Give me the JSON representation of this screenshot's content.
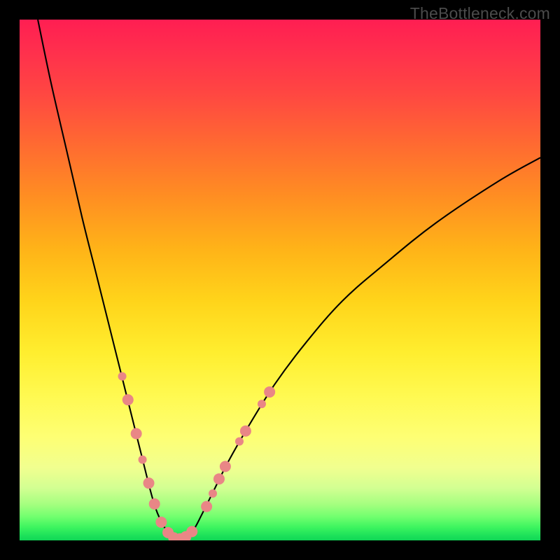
{
  "watermark": "TheBottleneck.com",
  "colors": {
    "frame": "#000000",
    "curve": "#000000",
    "marker_fill": "#e98686",
    "marker_stroke": "#d66d6d"
  },
  "chart_data": {
    "type": "line",
    "title": "",
    "xlabel": "",
    "ylabel": "",
    "xlim": [
      0,
      100
    ],
    "ylim": [
      0,
      100
    ],
    "grid": false,
    "legend": false,
    "series": [
      {
        "name": "bottleneck-curve",
        "x": [
          3.5,
          6,
          9,
          12,
          14.5,
          17,
          19,
          21,
          22.5,
          24,
          25,
          26,
          27,
          28,
          29,
          30,
          31,
          32,
          33.5,
          35,
          37,
          40,
          44,
          49,
          55,
          62,
          70,
          80,
          92,
          100
        ],
        "y": [
          100,
          88,
          75,
          62,
          52,
          42,
          34,
          26,
          20,
          14,
          10,
          6.5,
          4,
          2.2,
          1,
          0.3,
          0.2,
          0.8,
          2.2,
          5,
          9,
          15,
          22,
          30,
          38,
          46,
          53,
          61,
          69,
          73.5
        ]
      }
    ],
    "markers": [
      {
        "x": 19.7,
        "y": 31.5,
        "r": 6
      },
      {
        "x": 20.8,
        "y": 27.0,
        "r": 8
      },
      {
        "x": 22.4,
        "y": 20.5,
        "r": 8
      },
      {
        "x": 23.6,
        "y": 15.5,
        "r": 6
      },
      {
        "x": 24.8,
        "y": 11.0,
        "r": 8
      },
      {
        "x": 25.9,
        "y": 7.0,
        "r": 8
      },
      {
        "x": 27.2,
        "y": 3.5,
        "r": 8
      },
      {
        "x": 28.5,
        "y": 1.5,
        "r": 8
      },
      {
        "x": 29.6,
        "y": 0.5,
        "r": 8
      },
      {
        "x": 30.8,
        "y": 0.3,
        "r": 8
      },
      {
        "x": 31.9,
        "y": 0.7,
        "r": 8
      },
      {
        "x": 33.1,
        "y": 1.7,
        "r": 8
      },
      {
        "x": 35.9,
        "y": 6.5,
        "r": 8
      },
      {
        "x": 37.1,
        "y": 9.0,
        "r": 6
      },
      {
        "x": 38.3,
        "y": 11.8,
        "r": 8
      },
      {
        "x": 39.5,
        "y": 14.2,
        "r": 8
      },
      {
        "x": 42.2,
        "y": 19.0,
        "r": 6
      },
      {
        "x": 43.4,
        "y": 21.0,
        "r": 8
      },
      {
        "x": 46.5,
        "y": 26.2,
        "r": 6
      },
      {
        "x": 48.0,
        "y": 28.5,
        "r": 8
      }
    ]
  }
}
